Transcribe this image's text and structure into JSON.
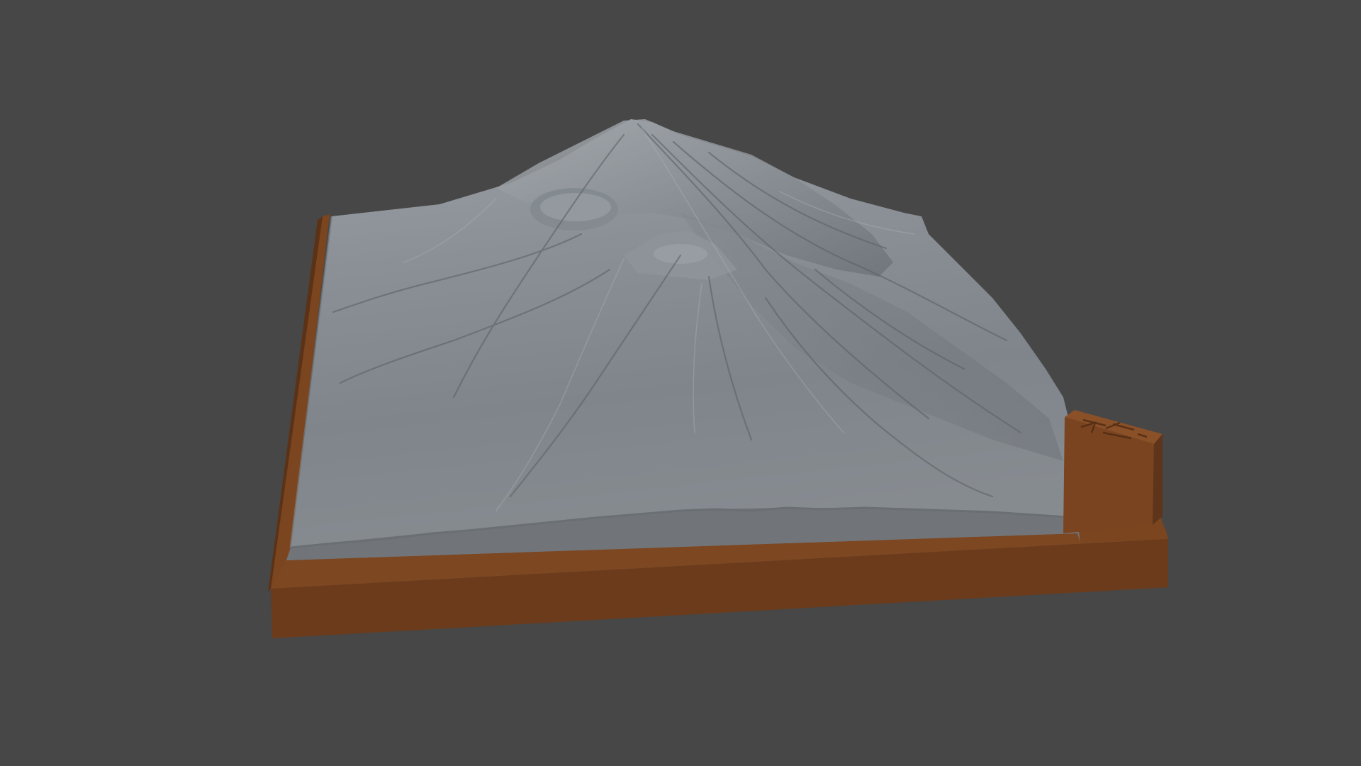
{
  "viewport": {
    "background": "#474747"
  },
  "scene": {
    "subject": "terrain-relief-model",
    "colors": {
      "terrain_light": "#8f9499",
      "terrain_mid": "#7b8086",
      "terrain_dark": "#5d6268",
      "terrain_side": "#6f7378",
      "base_top": "#7a451f",
      "base_front": "#6b3b1b",
      "base_side": "#5c3217",
      "tag_block": "#7a4420"
    }
  }
}
